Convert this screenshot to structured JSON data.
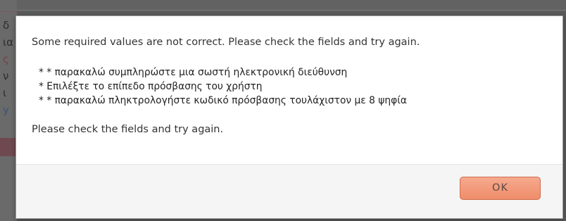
{
  "dialog": {
    "message": "Some required values are not correct. Please check the fields and try again.",
    "errors": [
      "* * παρακαλώ συμπληρώστε μια σωστή ηλεκτρονική διεύθυνση",
      "* Επιλέξτε το επίπεδο πρόσβασης του χρήστη",
      "* * παρακαλώ πληκτρολογήστε κωδικό πρόσβασης τουλάχιστον με 8 ψηφία"
    ],
    "footer": "Please check the fields and try again.",
    "ok_label": "OK"
  },
  "background": {
    "visible_chars": [
      "δ",
      "ια",
      "ς",
      "ν",
      "ι",
      "y"
    ]
  },
  "colors": {
    "overlay": "#5a5a5a",
    "dialog_bg": "#ffffff",
    "buttonpane_bg": "#f5f5f5",
    "ok_button": "#f19a7a"
  }
}
